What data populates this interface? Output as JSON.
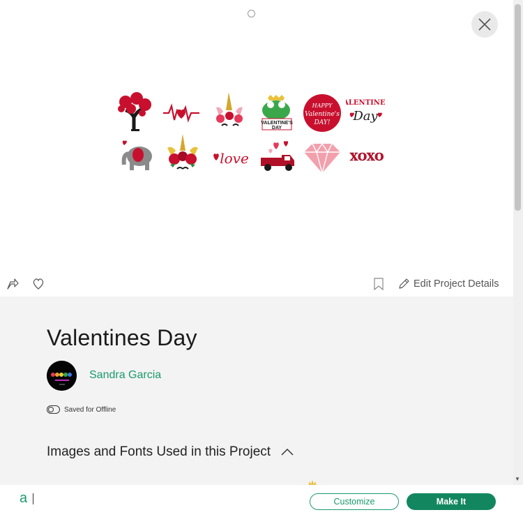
{
  "canvas": {
    "handle_icon": "rotate-handle-icon",
    "close_icon": "close-icon",
    "designs": [
      {
        "name": "heart-tree-design"
      },
      {
        "name": "heartbeat-design"
      },
      {
        "name": "unicorn-hearts-design"
      },
      {
        "name": "frog-valentines-day-design"
      },
      {
        "name": "happy-valentines-day-circle-design"
      },
      {
        "name": "valentines-day-text-design"
      },
      {
        "name": "elephant-heart-design"
      },
      {
        "name": "unicorn-roses-design"
      },
      {
        "name": "love-script-design"
      },
      {
        "name": "truck-hearts-design"
      },
      {
        "name": "diamond-design"
      },
      {
        "name": "xoxo-design"
      }
    ]
  },
  "actionbar": {
    "edit_label": "Edit Project Details"
  },
  "project": {
    "title": "Valentines Day",
    "author": "Sandra Garcia",
    "offline_label": "Saved for Offline",
    "section_heading": "Images and Fonts Used in this Project"
  },
  "footer": {
    "logo": "a",
    "customize_label": "Customize",
    "makeit_label": "Make It"
  },
  "colors": {
    "accent": "#1a9a6b",
    "primary_button": "#12875f",
    "canvas_bg": "#dcdcdc"
  }
}
